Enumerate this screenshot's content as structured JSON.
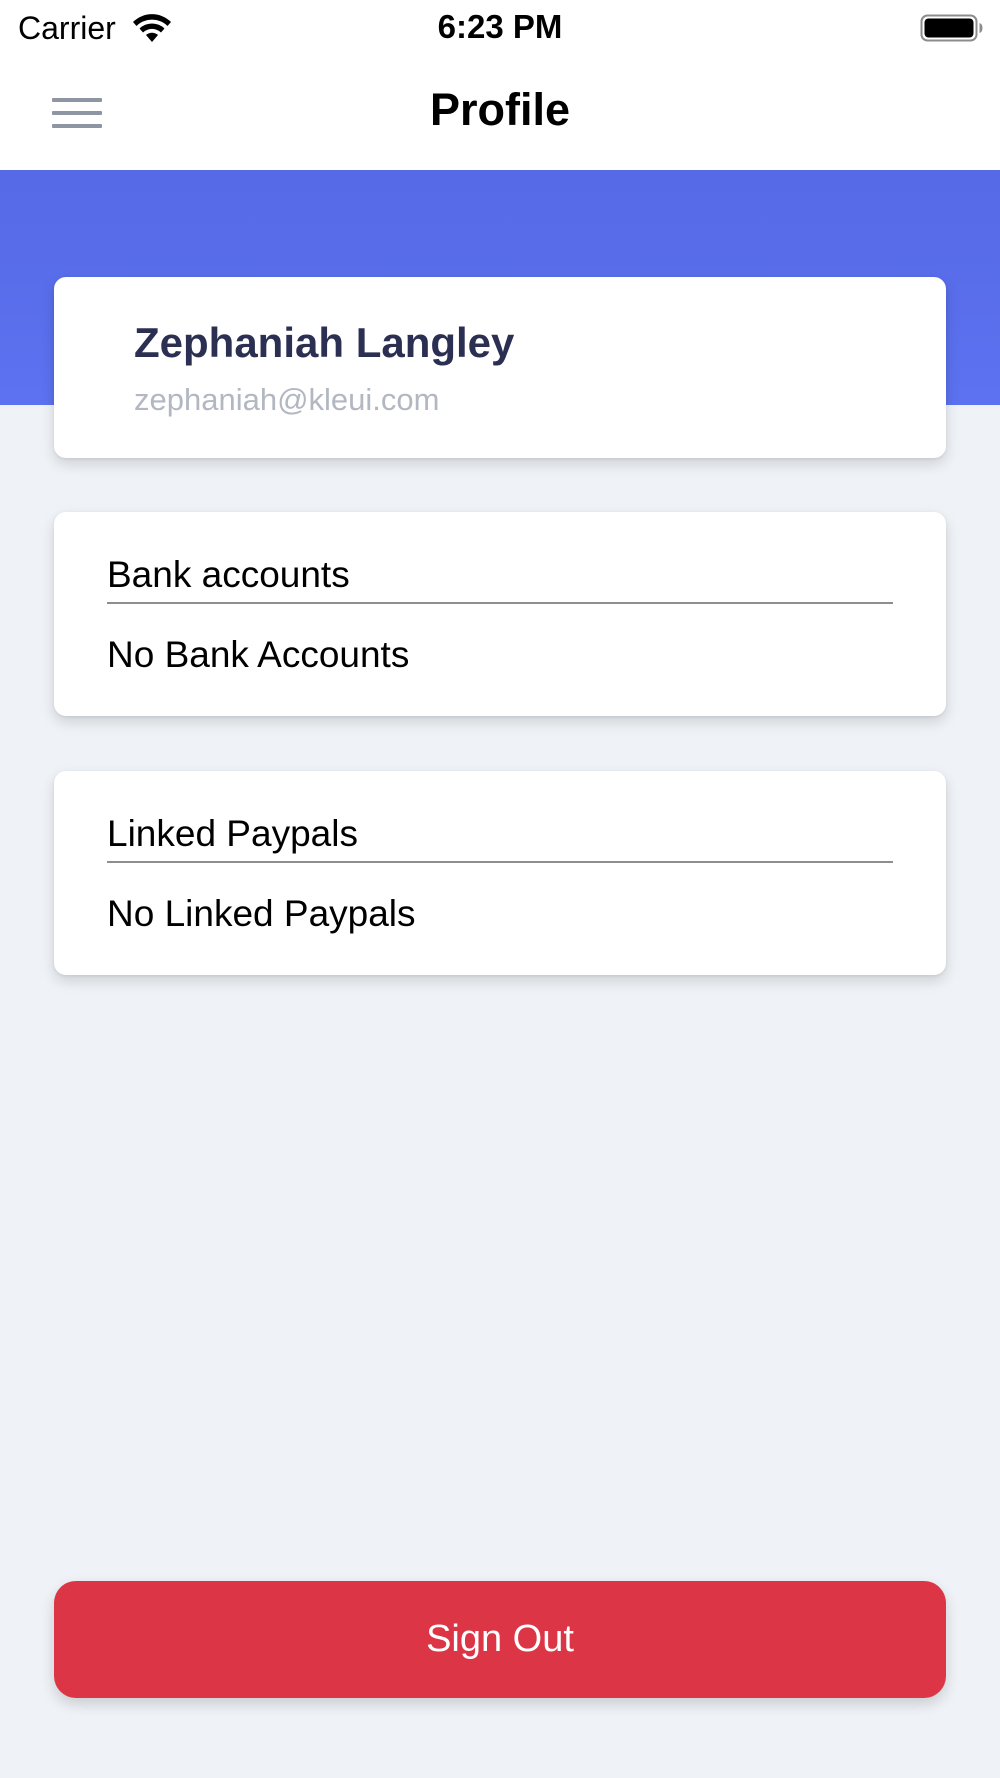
{
  "status_bar": {
    "carrier": "Carrier",
    "time": "6:23 PM",
    "icons": [
      "wifi-icon",
      "battery-icon"
    ]
  },
  "nav": {
    "title": "Profile",
    "menu_icon": "hamburger-menu-icon"
  },
  "profile": {
    "name": "Zephaniah Langley",
    "email": "zephaniah@kleui.com"
  },
  "bank_accounts": {
    "title": "Bank accounts",
    "empty_text": "No Bank Accounts"
  },
  "paypals": {
    "title": "Linked Paypals",
    "empty_text": "No Linked Paypals"
  },
  "actions": {
    "sign_out_label": "Sign Out"
  },
  "colors": {
    "hero_blue": "#5a6eec",
    "sign_out_red": "#dc3545",
    "background": "#eff3f7",
    "name_text": "#2b3052",
    "email_text": "#b2b7c2"
  }
}
